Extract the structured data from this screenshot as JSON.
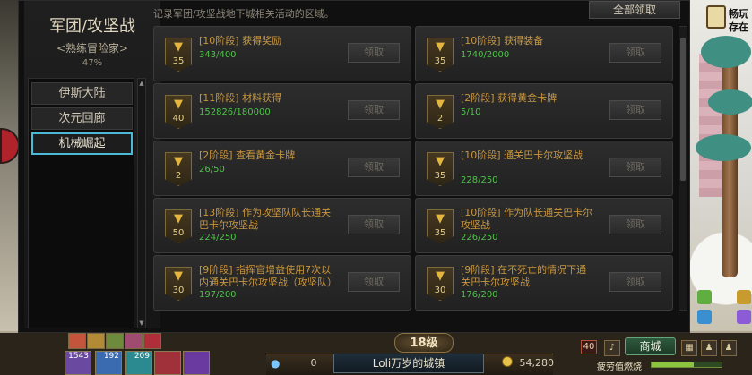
{
  "window": {
    "title": "军团/攻坚战",
    "rank": "<熟练冒险家>",
    "progress_percent": "47%",
    "description": "记录军团/攻坚战地下城相关活动的区域。",
    "claim_all_label": "全部领取",
    "nav": [
      "伊斯大陆",
      "次元回廊",
      "机械崛起"
    ],
    "nav_selected": 2
  },
  "achievements": [
    {
      "level": "35",
      "title": "[10阶段] 获得奖励",
      "progress": "343/400",
      "button": "领取"
    },
    {
      "level": "35",
      "title": "[10阶段] 获得装备",
      "progress": "1740/2000",
      "button": "领取"
    },
    {
      "level": "40",
      "title": "[11阶段] 材料获得",
      "progress": "152826/180000",
      "button": "领取"
    },
    {
      "level": "2",
      "title": "[2阶段] 获得黄金卡牌",
      "progress": "5/10",
      "button": "领取"
    },
    {
      "level": "2",
      "title": "[2阶段] 查看黄金卡牌",
      "progress": "26/50",
      "button": "领取"
    },
    {
      "level": "35",
      "title": "[10阶段] 通关巴卡尔攻坚战",
      "progress": "228/250",
      "button": "领取"
    },
    {
      "level": "50",
      "title": "[13阶段] 作为攻坚队队长通关巴卡尔攻坚战",
      "progress": "224/250",
      "button": "领取"
    },
    {
      "level": "35",
      "title": "[10阶段] 作为队长通关巴卡尔攻坚战",
      "progress": "226/250",
      "button": "领取"
    },
    {
      "level": "30",
      "title": "[9阶段] 指挥官增益使用7次以内通关巴卡尔攻坚战（攻坚队）",
      "progress": "197/200",
      "button": "领取"
    },
    {
      "level": "30",
      "title": "[9阶段] 在不死亡的情况下通关巴卡尔攻坚战",
      "progress": "176/200",
      "button": "领取"
    }
  ],
  "hud": {
    "level": "18级",
    "fatigue_points": "0",
    "town": "Loli万岁的城镇",
    "gold": "54,280",
    "char_level": "40",
    "shop": "商城",
    "fatigue_label": "疲劳值燃烧",
    "fatigue_fraction": 0.6,
    "skill_counts": [
      "1543",
      "192",
      "209"
    ]
  },
  "scene": {
    "top_right_text": [
      "畅玩",
      "存在"
    ]
  },
  "colors": {
    "accent_selected": "#4bbad8",
    "title_gold": "#c9963e",
    "progress_green": "#4fc24a",
    "trophy_gold": "#e2b63f"
  },
  "icons": {
    "trophy": "trophy-icon",
    "paw": "paw-icon",
    "coin": "coin-icon",
    "shop": "shop-icon"
  }
}
